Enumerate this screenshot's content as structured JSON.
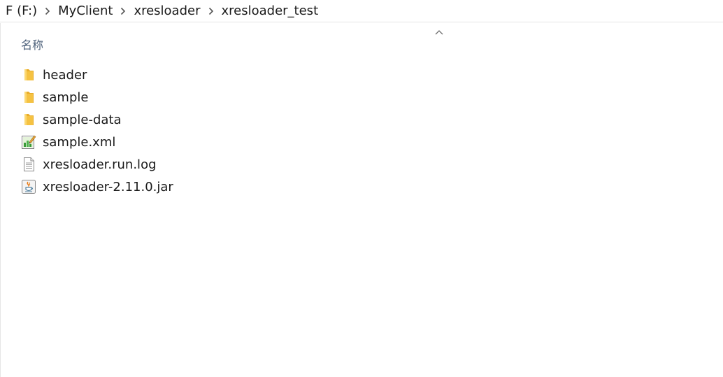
{
  "breadcrumb": {
    "items": [
      "F (F:)",
      "MyClient",
      "xresloader",
      "xresloader_test"
    ]
  },
  "column_header": "名称",
  "files": [
    {
      "name": "header",
      "icon": "folder-icon"
    },
    {
      "name": "sample",
      "icon": "folder-icon"
    },
    {
      "name": "sample-data",
      "icon": "folder-icon"
    },
    {
      "name": "sample.xml",
      "icon": "xml-file-icon"
    },
    {
      "name": "xresloader.run.log",
      "icon": "text-file-icon"
    },
    {
      "name": "xresloader-2.11.0.jar",
      "icon": "jar-file-icon"
    }
  ],
  "colors": {
    "folder": "#f5c242",
    "header_text": "#4c607a",
    "separator": "#e5e5e5"
  }
}
